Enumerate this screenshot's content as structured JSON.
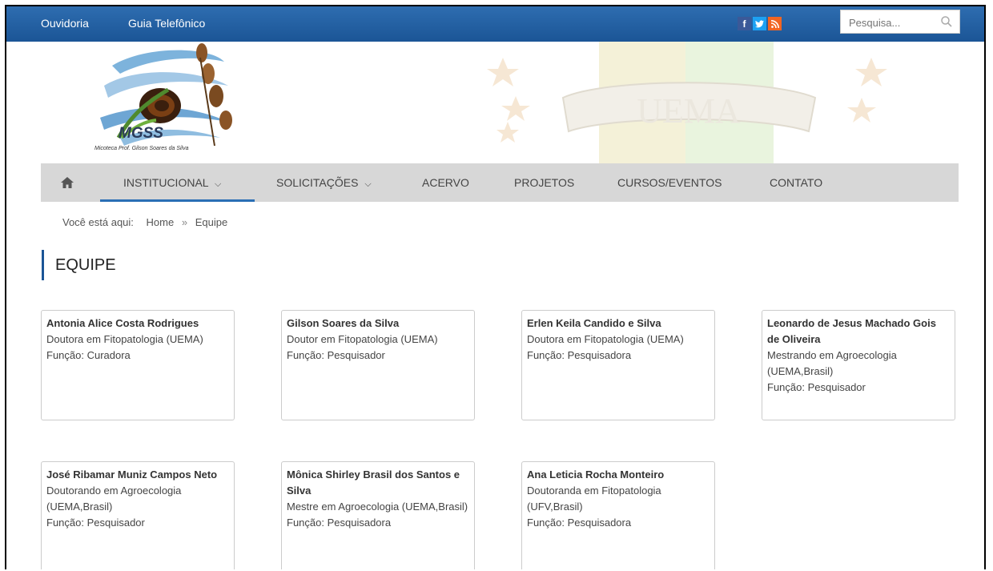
{
  "topbar": {
    "links": [
      "Ouvidoria",
      "Guia Telefônico"
    ],
    "social": [
      {
        "icon": "facebook-icon",
        "glyph": "f",
        "color": "#3b5998"
      },
      {
        "icon": "twitter-icon",
        "glyph": "t",
        "color": "#1da1f2"
      },
      {
        "icon": "rss-icon",
        "glyph": "r",
        "color": "#f26522"
      }
    ],
    "search_placeholder": "Pesquisa..."
  },
  "logo": {
    "title": "MGSS",
    "subtitle": "Micoteca Prof. Gilson Soares da Silva"
  },
  "crest": {
    "text": "UEMA"
  },
  "nav": {
    "home_icon": "home-icon",
    "items": [
      "INSTITUCIONAL",
      "SOLICITAÇÕES",
      "ACERVO",
      "PROJETOS",
      "CURSOS/EVENTOS",
      "CONTATO"
    ],
    "dropdown_glyph": "⌄"
  },
  "breadcrumb": {
    "label": "Você está aqui:",
    "home": "Home",
    "sep": "»",
    "current": "Equipe"
  },
  "page": {
    "title": "EQUIPE"
  },
  "team": [
    {
      "name": "Antonia Alice Costa Rodrigues",
      "degree": "Doutora em Fitopatologia (UEMA)",
      "role": "Função: Curadora"
    },
    {
      "name": "Gilson Soares da Silva",
      "degree": "Doutor em Fitopatologia (UEMA)",
      "role": "Função: Pesquisador"
    },
    {
      "name": "Erlen Keila Candido e Silva",
      "degree": "Doutora em Fitopatologia (UEMA)",
      "role": "Função: Pesquisadora"
    },
    {
      "name": "Leonardo de Jesus Machado Gois de Oliveira",
      "degree": "Mestrando em Agroecologia (UEMA,Brasil)",
      "role": "Função: Pesquisador"
    },
    {
      "name": "José Ribamar Muniz Campos Neto",
      "degree": "Doutorando em Agroecologia (UEMA,Brasil)",
      "role": "Função: Pesquisador"
    },
    {
      "name": "Mônica Shirley Brasil dos Santos e Silva",
      "degree": "Mestre em Agroecologia (UEMA,Brasil)",
      "role": "Função: Pesquisadora"
    },
    {
      "name": "Ana Leticia Rocha Monteiro",
      "degree": "Doutoranda em Fitopatologia (UFV,Brasil)",
      "role": "Função: Pesquisadora"
    }
  ]
}
